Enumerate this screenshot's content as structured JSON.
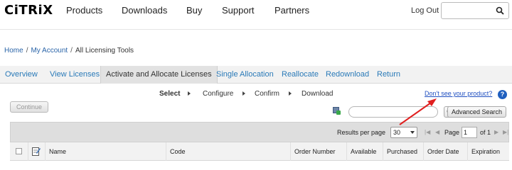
{
  "brand": {
    "logo_text": "CiTRiX"
  },
  "header": {
    "nav": [
      "Products",
      "Downloads",
      "Buy",
      "Support",
      "Partners"
    ],
    "logout": "Log Out",
    "search_placeholder": ""
  },
  "breadcrumb": {
    "home": "Home",
    "account": "My Account",
    "current": "All Licensing Tools",
    "separator": "/"
  },
  "tabs": [
    "Overview",
    "View Licenses",
    "Activate and Allocate Licenses",
    "Single Allocation",
    "Reallocate",
    "Redownload",
    "Return"
  ],
  "active_tab": "Activate and Allocate Licenses",
  "steps": [
    "Select",
    "Configure",
    "Confirm",
    "Download"
  ],
  "current_step": "Select",
  "help": {
    "link": "Don't see your product?",
    "icon": "?"
  },
  "actions": {
    "continue": "Continue",
    "advanced_search": "Advanced Search"
  },
  "pager": {
    "results_label": "Results per page",
    "results_value": "30",
    "page_label": "Page",
    "page_value": "1",
    "of_text": "of 1"
  },
  "table": {
    "columns": [
      "Name",
      "Code",
      "Order Number",
      "Available",
      "Purchased",
      "Order Date",
      "Expiration"
    ]
  },
  "colors": {
    "link": "#2a7ab8",
    "annotation": "#e02020",
    "help": "#1f5fbf"
  }
}
